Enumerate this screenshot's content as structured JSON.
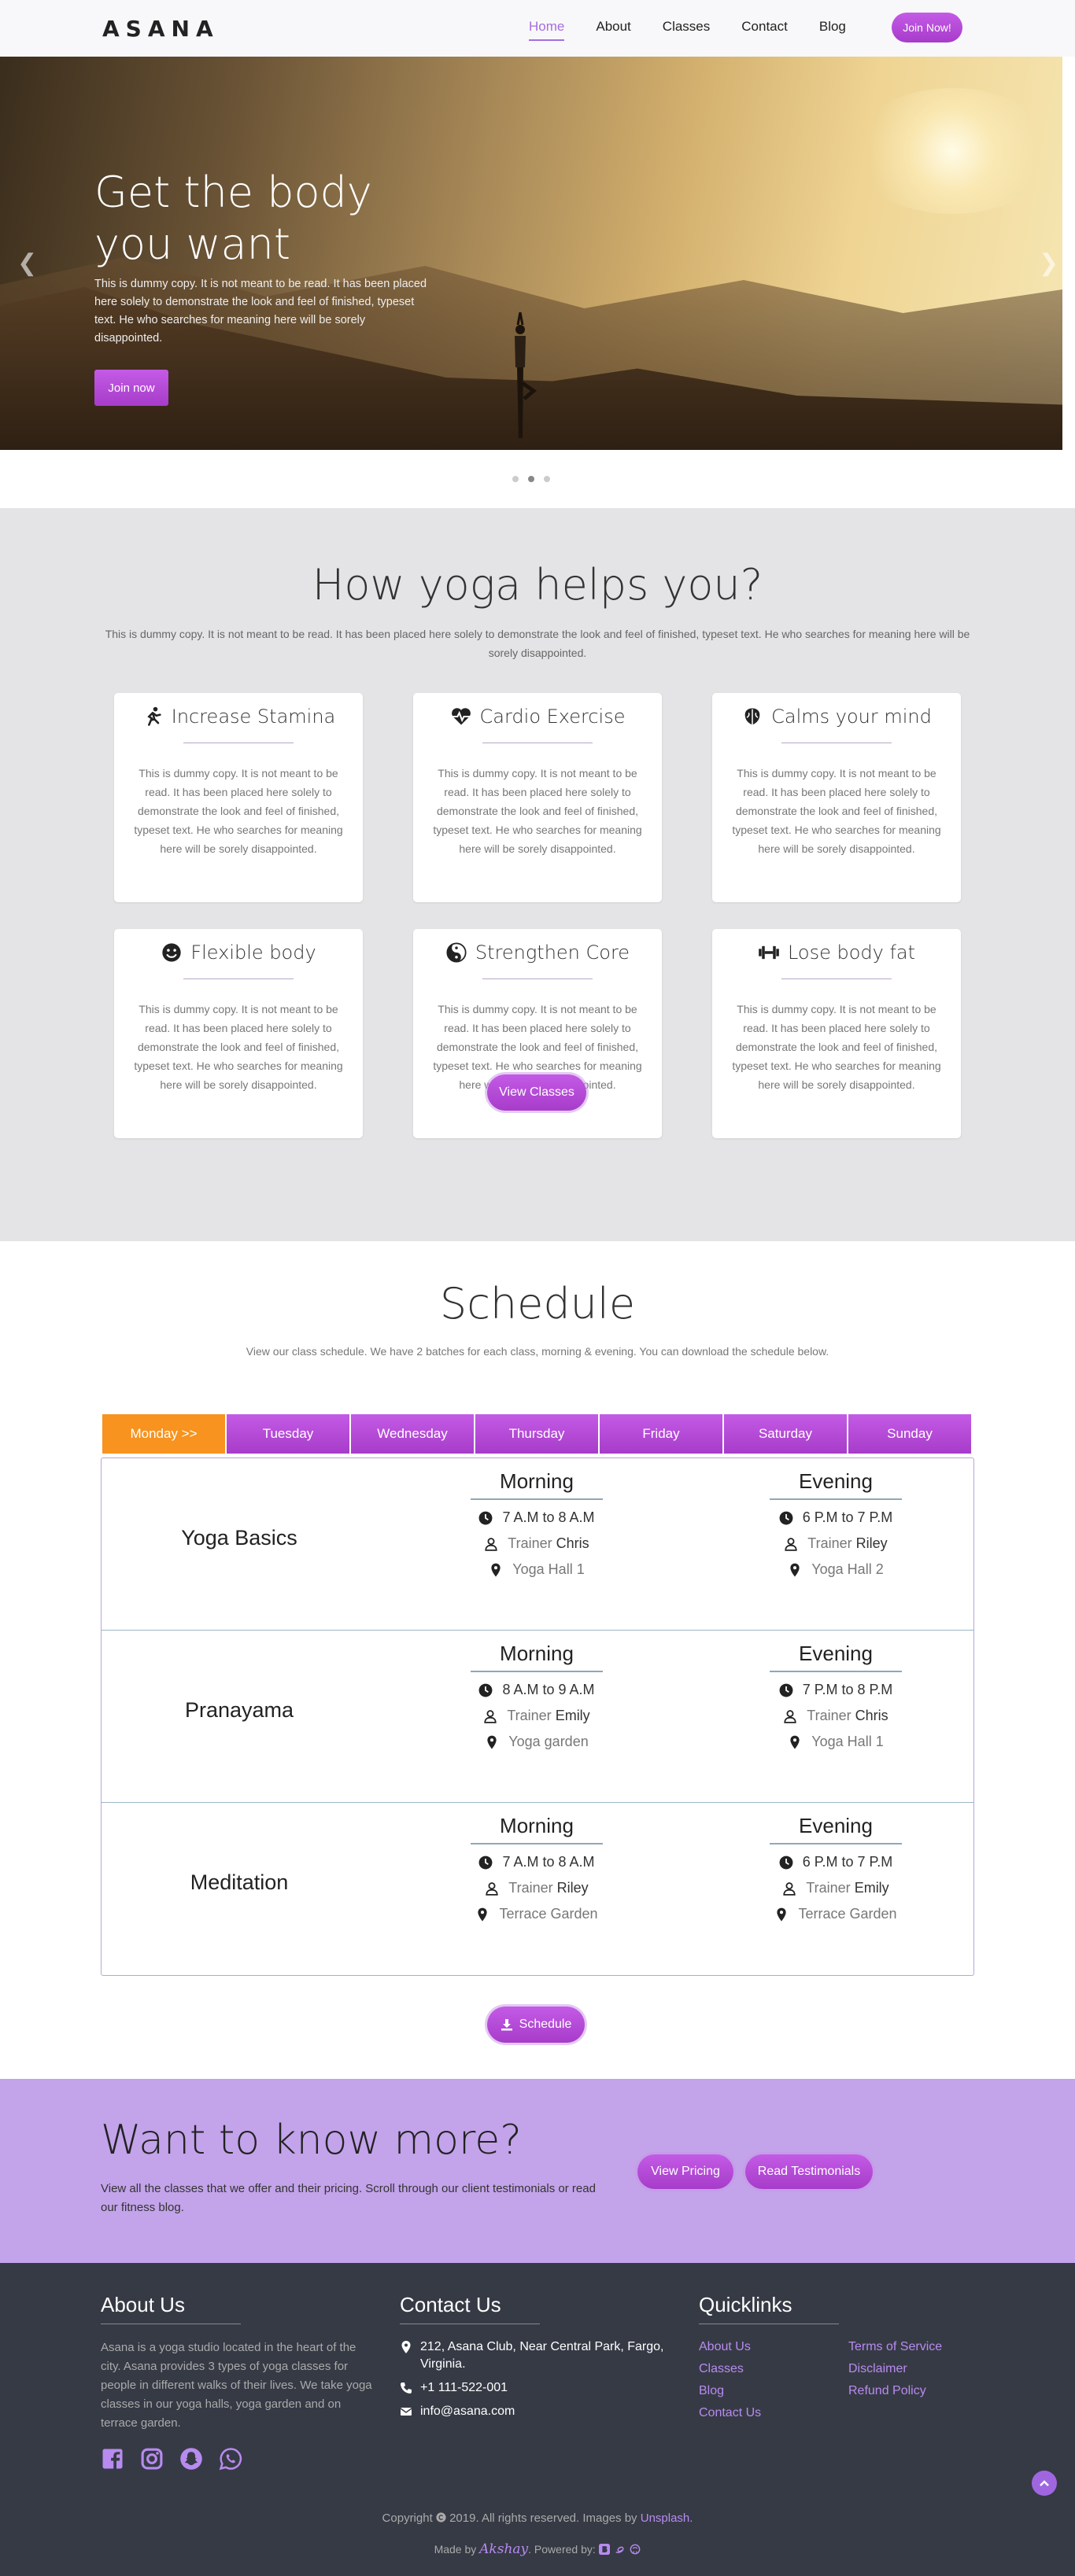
{
  "nav": {
    "logo": "ASANA",
    "links": [
      "Home",
      "About",
      "Classes",
      "Contact",
      "Blog"
    ],
    "cta": "Join Now!"
  },
  "hero": {
    "title": "Get the body you want",
    "text": "This is dummy copy. It is not meant to be read. It has been placed here solely to demonstrate the look and feel of finished, typeset text. He who searches for meaning here will be sorely disappointed.",
    "button": "Join now"
  },
  "benefits": {
    "title": "How yoga helps you?",
    "lead": "This is dummy copy. It is not meant to be read. It has been placed here solely to demonstrate the look and feel of finished, typeset text. He who searches for meaning here will be sorely disappointed.",
    "cards": [
      {
        "title": "Increase Stamina",
        "icon": "running-icon",
        "text": "This is dummy copy. It is not meant to be read. It has been placed here solely to demonstrate the look and feel of finished, typeset text. He who searches for meaning here will be sorely disappointed."
      },
      {
        "title": "Cardio Exercise",
        "icon": "heartbeat-icon",
        "text": "This is dummy copy. It is not meant to be read. It has been placed here solely to demonstrate the look and feel of finished, typeset text. He who searches for meaning here will be sorely disappointed."
      },
      {
        "title": "Calms your mind",
        "icon": "brain-icon",
        "text": "This is dummy copy. It is not meant to be read. It has been placed here solely to demonstrate the look and feel of finished, typeset text. He who searches for meaning here will be sorely disappointed."
      },
      {
        "title": "Flexible body",
        "icon": "smile-icon",
        "text": "This is dummy copy. It is not meant to be read. It has been placed here solely to demonstrate the look and feel of finished, typeset text. He who searches for meaning here will be sorely disappointed."
      },
      {
        "title": "Strengthen Core",
        "icon": "yin-yang-icon",
        "text": "This is dummy copy. It is not meant to be read. It has been placed here solely to demonstrate the look and feel of finished, typeset text. He who searches for meaning here will be sorely disappointed."
      },
      {
        "title": "Lose body fat",
        "icon": "dumbbell-icon",
        "text": "This is dummy copy. It is not meant to be read. It has been placed here solely to demonstrate the look and feel of finished, typeset text. He who searches for meaning here will be sorely disappointed."
      }
    ],
    "button": "View Classes"
  },
  "schedule": {
    "title": "Schedule",
    "lead": "View our class schedule. We have 2 batches for each class, morning & evening. You can download the schedule below.",
    "days": [
      "Monday >>",
      "Tuesday",
      "Wednesday",
      "Thursday",
      "Friday",
      "Saturday",
      "Sunday"
    ],
    "trainer_prefix": "Trainer",
    "classes": [
      {
        "name": "Yoga Basics",
        "morning": {
          "label": "Morning",
          "time": "7 A.M to 8 A.M",
          "trainer": "Chris",
          "place": "Yoga Hall 1"
        },
        "evening": {
          "label": "Evening",
          "time": "6 P.M to 7 P.M",
          "trainer": "Riley",
          "place": "Yoga Hall 2"
        }
      },
      {
        "name": "Pranayama",
        "morning": {
          "label": "Morning",
          "time": "8 A.M to 9 A.M",
          "trainer": "Emily",
          "place": "Yoga garden"
        },
        "evening": {
          "label": "Evening",
          "time": "7 P.M to 8 P.M",
          "trainer": "Chris",
          "place": "Yoga Hall 1"
        }
      },
      {
        "name": "Meditation",
        "morning": {
          "label": "Morning",
          "time": "7 A.M to 8 A.M",
          "trainer": "Riley",
          "place": "Terrace Garden"
        },
        "evening": {
          "label": "Evening",
          "time": "6 P.M to 7 P.M",
          "trainer": "Emily",
          "place": "Terrace Garden"
        }
      }
    ],
    "download": "Schedule"
  },
  "cta": {
    "title": "Want to know more?",
    "text": "View all the classes that we offer and their pricing. Scroll through our client testimonials or read our fitness blog.",
    "pricing": "View Pricing",
    "testimonials": "Read Testimonials"
  },
  "footer": {
    "about_title": "About Us",
    "about": "Asana is a yoga studio located in the heart of the city. Asana provides 3 types of yoga classes for people in different walks of their lives. We take yoga classes in our yoga halls, yoga garden and on terrace garden.",
    "social_icons": [
      "facebook-icon",
      "instagram-icon",
      "snapchat-icon",
      "whatsapp-icon"
    ],
    "contact_title": "Contact Us",
    "address": "212, Asana Club, Near Central Park, Fargo, Virginia.",
    "phone": "+1 111-522-001",
    "email": "info@asana.com",
    "quick_title": "Quicklinks",
    "quick_left": [
      "About Us",
      "Classes",
      "Blog",
      "Contact Us"
    ],
    "quick_right": [
      "Terms of Service",
      "Disclaimer",
      "Refund Policy"
    ],
    "copyright_pre": "Copyright",
    "copyright_year": "2019. All rights reserved. Images by",
    "copyright_link": "Unsplash.",
    "made_by": "Made by",
    "author": "Akshay",
    "powered": ". Powered by:"
  },
  "colors": {
    "accent": "#a66de0",
    "button": "#b84ad6",
    "active_tab": "#f7931e",
    "cta_bg": "#c3a3ea",
    "footer_bg": "#363a45",
    "section_bg": "#e4e4e6"
  }
}
